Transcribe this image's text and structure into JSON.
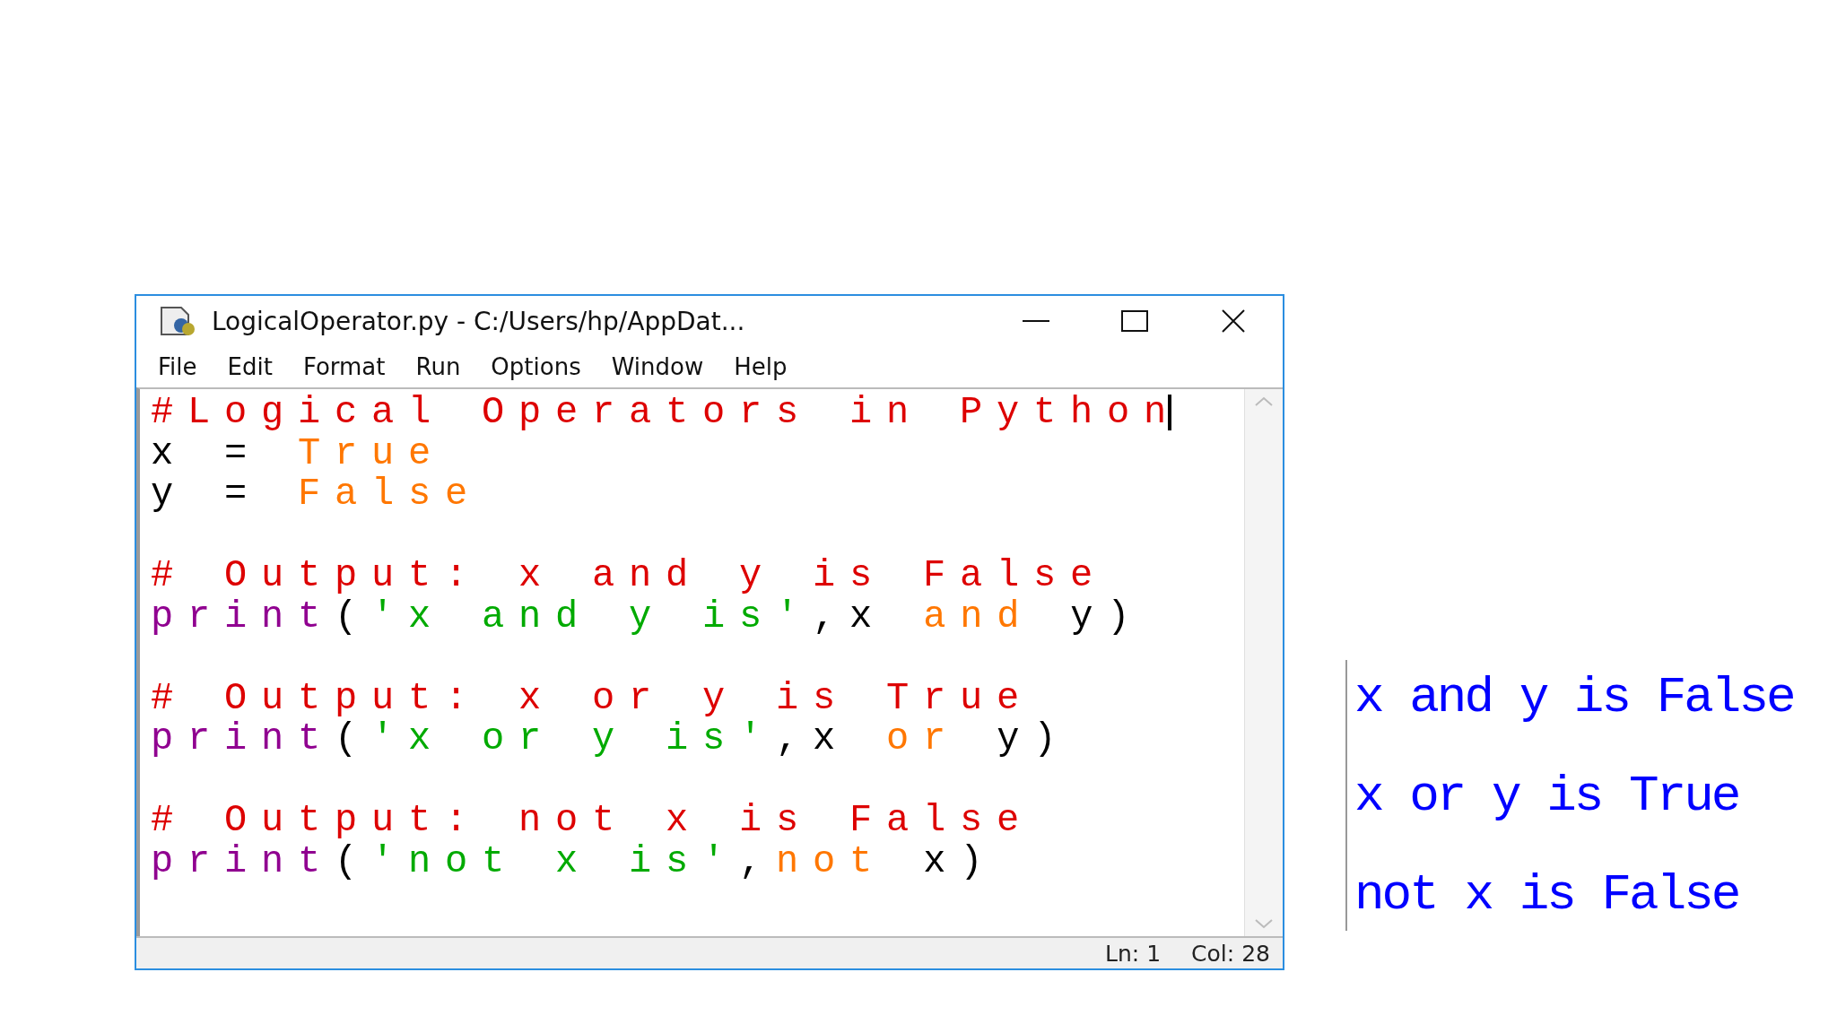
{
  "window": {
    "title": "LogicalOperator.py - C:/Users/hp/AppDat..."
  },
  "menu": [
    "File",
    "Edit",
    "Format",
    "Run",
    "Options",
    "Window",
    "Help"
  ],
  "code_lines": [
    {
      "kind": "code",
      "tokens": [
        {
          "kind": "comment",
          "text": "#Logical Operators in Python"
        }
      ]
    },
    {
      "kind": "code",
      "tokens": [
        {
          "kind": "plain",
          "text": "x = "
        },
        {
          "kind": "keyword",
          "text": "True"
        }
      ]
    },
    {
      "kind": "code",
      "tokens": [
        {
          "kind": "plain",
          "text": "y = "
        },
        {
          "kind": "keyword",
          "text": "False"
        }
      ]
    },
    {
      "kind": "blank"
    },
    {
      "kind": "code",
      "tokens": [
        {
          "kind": "comment",
          "text": "# Output: x and y is False"
        }
      ]
    },
    {
      "kind": "code",
      "tokens": [
        {
          "kind": "builtin",
          "text": "print"
        },
        {
          "kind": "plain",
          "text": "("
        },
        {
          "kind": "string",
          "text": "'x and y is'"
        },
        {
          "kind": "plain",
          "text": ",x "
        },
        {
          "kind": "keyword",
          "text": "and"
        },
        {
          "kind": "plain",
          "text": " y)"
        }
      ]
    },
    {
      "kind": "blank"
    },
    {
      "kind": "code",
      "tokens": [
        {
          "kind": "comment",
          "text": "# Output: x or y is True"
        }
      ]
    },
    {
      "kind": "code",
      "tokens": [
        {
          "kind": "builtin",
          "text": "print"
        },
        {
          "kind": "plain",
          "text": "("
        },
        {
          "kind": "string",
          "text": "'x or y is'"
        },
        {
          "kind": "plain",
          "text": ",x "
        },
        {
          "kind": "keyword",
          "text": "or"
        },
        {
          "kind": "plain",
          "text": " y)"
        }
      ]
    },
    {
      "kind": "blank"
    },
    {
      "kind": "code",
      "tokens": [
        {
          "kind": "comment",
          "text": "# Output: not x is False"
        }
      ]
    },
    {
      "kind": "code",
      "tokens": [
        {
          "kind": "builtin",
          "text": "print"
        },
        {
          "kind": "plain",
          "text": "("
        },
        {
          "kind": "string",
          "text": "'not x is'"
        },
        {
          "kind": "plain",
          "text": ","
        },
        {
          "kind": "keyword",
          "text": "not"
        },
        {
          "kind": "plain",
          "text": " x)"
        }
      ]
    }
  ],
  "status_bar": {
    "line": "Ln: 1",
    "column": "Col: 28"
  },
  "output": [
    "x and y is False",
    "x or y is True",
    "not x is False"
  ]
}
